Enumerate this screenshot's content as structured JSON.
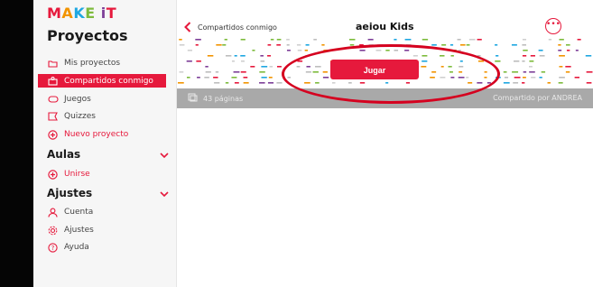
{
  "sidebar": {
    "logo_chars": [
      "M",
      "A",
      "K",
      "E",
      " ",
      "i",
      "T"
    ],
    "sections": {
      "projects": "Proyectos",
      "classes": "Aulas",
      "settings": "Ajustes"
    },
    "items": [
      {
        "label": "Mis proyectos",
        "icon": "folder-icon",
        "active": false
      },
      {
        "label": "Compartidos conmigo",
        "icon": "share-icon",
        "active": true
      },
      {
        "label": "Juegos",
        "icon": "gamepad-icon",
        "active": false
      },
      {
        "label": "Quizzes",
        "icon": "quiz-icon",
        "active": false
      },
      {
        "label": "Nuevo proyecto",
        "icon": "plus-circle-icon",
        "active": false
      }
    ],
    "class_items": [
      {
        "label": "Unirse",
        "icon": "plus-circle-icon"
      }
    ],
    "settings_items": [
      {
        "label": "Cuenta",
        "icon": "user-icon"
      },
      {
        "label": "Ajustes",
        "icon": "gear-icon"
      },
      {
        "label": "Ayuda",
        "icon": "help-icon"
      }
    ]
  },
  "header": {
    "back_label": "Compartidos conmigo",
    "title": "aeiou Kids",
    "more_icon": "more-icon"
  },
  "banner": {
    "play_button": "Jugar",
    "pages": "43 páginas",
    "shared_by": "Compartido por ANDREA"
  },
  "colors": {
    "accent": "#e6193c",
    "highlight_ring": "#d5001f"
  }
}
